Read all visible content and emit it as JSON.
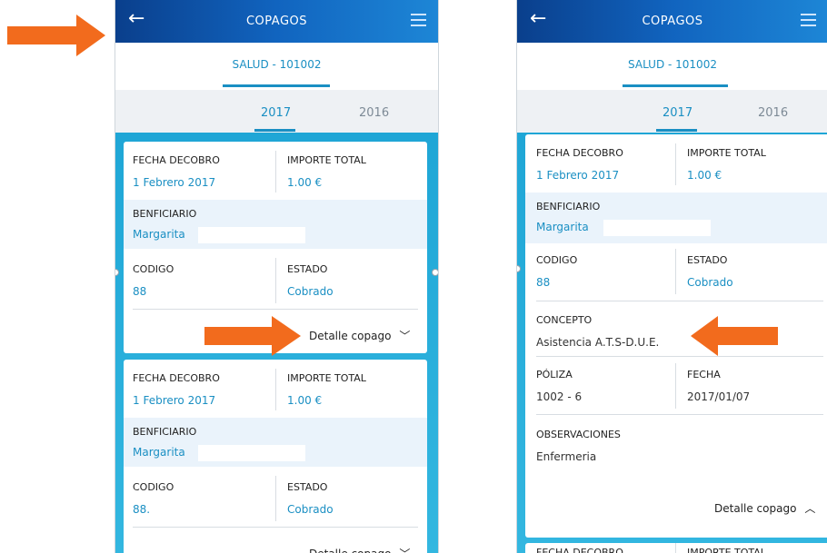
{
  "header": {
    "title": "COPAGOS",
    "back_glyph": "←"
  },
  "policy": {
    "label": "SALUD - 101002"
  },
  "years": {
    "active": "2017",
    "inactive": "2016"
  },
  "colors": {
    "accent": "#1a8fc3",
    "header_start": "#0a3f8c",
    "header_end": "#1d86d6",
    "arrow": "#f26b1d",
    "list_bg": "#1fa6d6"
  },
  "labels": {
    "fecha_cobro": "FECHA DECOBRO",
    "importe_total": "IMPORTE TOTAL",
    "beneficiario": "BENFICIARIO",
    "codigo": "CODIGO",
    "estado": "ESTADO",
    "concepto": "CONCEPTO",
    "poliza": "PÓLIZA",
    "fecha": "FECHA",
    "observaciones": "OBSERVACIONES"
  },
  "card": {
    "fecha_cobro": "1 Febrero 2017",
    "importe_total": "1.00 €",
    "beneficiario": "Margarita",
    "codigo": "88",
    "codigo_alt": "88.",
    "estado": "Cobrado",
    "detail_label": "Detalle copago"
  },
  "expanded": {
    "concepto": "Asistencia A.T.S-D.U.E.",
    "poliza": "1002 - 6",
    "fecha": "2017/01/07",
    "observaciones": "Enfermeria"
  },
  "icons": {
    "back": "back-arrow-icon",
    "menu": "menu-icon",
    "chevron_down": "chevron-down-icon",
    "chevron_up": "chevron-up-icon"
  }
}
